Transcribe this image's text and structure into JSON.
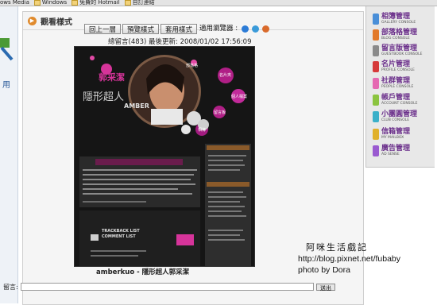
{
  "bookmarks": [
    {
      "label": "ows Media"
    },
    {
      "label": "Windows"
    },
    {
      "label": "免費的 Hotmail"
    },
    {
      "label": "自訂連結"
    }
  ],
  "left_strip": {
    "label": "用"
  },
  "panel": {
    "title": "觀看樣式",
    "toolbar": {
      "back": "回上一層",
      "preview": "預覽樣式",
      "apply": "套用樣式",
      "browser": "適用瀏覽器 :"
    },
    "stats": "總留言(483) 最後更新: 2008/01/02 17:56:09",
    "preview_caption": "amberkuo - 隱形超人郭采潔",
    "comment_label": "留言:",
    "comment_button": "送出"
  },
  "blog_preview": {
    "title_art": "隱形超人",
    "name_art": "郭采潔",
    "amber": "AMBER",
    "menu_bubbles": [
      "名片夾",
      "個人檔案",
      "留言板",
      "相簿",
      "部落格"
    ],
    "trackback": "TRACKBACK LIST",
    "comment_list": "COMMENT LIST"
  },
  "sidebar": {
    "items": [
      {
        "zh": "相簿管理",
        "en": "GALLERY CONSOLE",
        "color": "#4a8fd8"
      },
      {
        "zh": "部落格管理",
        "en": "BLOG CONSOLE",
        "color": "#e27a2b"
      },
      {
        "zh": "留言版管理",
        "en": "GUESTBOOK CONSOLE",
        "color": "#8a8a8a"
      },
      {
        "zh": "名片管理",
        "en": "PROFILE CONSOLE",
        "color": "#d63a3a"
      },
      {
        "zh": "社群管理",
        "en": "PEOPLE CONSOLE",
        "color": "#e569b2"
      },
      {
        "zh": "帳戶管理",
        "en": "ACCOUNT CONSOLE",
        "color": "#8bc43f"
      },
      {
        "zh": "小團圓管理",
        "en": "CLUB CONSOLE",
        "color": "#3bb0c9"
      },
      {
        "zh": "信箱管理",
        "en": "MY MAILBOX",
        "color": "#e0b02a"
      },
      {
        "zh": "廣告管理",
        "en": "AD SENSE",
        "color": "#9a5ad0"
      }
    ]
  },
  "watermark": {
    "logo": "阿咪生活戲記",
    "url": "http://blog.pixnet.net/fubaby",
    "credit": "photo by Dora"
  }
}
